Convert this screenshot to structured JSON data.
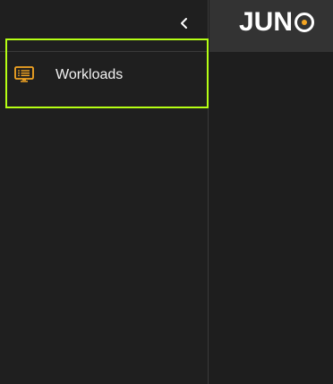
{
  "brand": {
    "logo_text": "JUNO",
    "logo_prefix": "JU",
    "logo_mid": "N",
    "accent_color": "#f5a623"
  },
  "sidebar": {
    "collapse_icon": "chevron-left-icon",
    "items": [
      {
        "label": "Workloads",
        "icon": "list-icon",
        "selected": true,
        "highlight_color": "#b5ff14"
      }
    ]
  }
}
